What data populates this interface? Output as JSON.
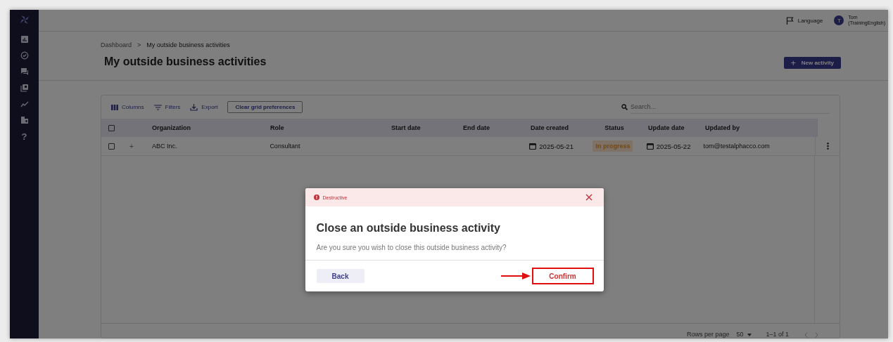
{
  "sidebar": {
    "help_glyph": "?"
  },
  "topbar": {
    "language": "Language",
    "user_initial": "T",
    "user_name": "Tom",
    "user_detail": "(TrainingEnglish)"
  },
  "breadcrumb": [
    "Dashboard",
    "My outside business activities"
  ],
  "breadcrumb_separator": ">",
  "page_title": "My outside business activities",
  "new_button": {
    "icon_glyph": "+",
    "label": "New activity"
  },
  "toolbar": {
    "columns": "Columns",
    "filters": "Filters",
    "export": "Export",
    "clear": "Clear grid preferences",
    "search_placeholder": "Search..."
  },
  "table": {
    "header_checked": false,
    "columns": [
      "Organization",
      "Role",
      "Start date",
      "End date",
      "Date created",
      "Status",
      "Update date",
      "Updated by"
    ],
    "rows": [
      {
        "checked": false,
        "expand_glyph": "+",
        "organization": "ABC Inc.",
        "role": "Consultant",
        "date_created": "2025-05-21",
        "status": "In progress",
        "update_date": "2025-05-22",
        "updated_by": "tom@testalphacco.com"
      }
    ]
  },
  "footer": {
    "rows_per_page_label": "Rows per page",
    "rows_per_page": "50",
    "range": "1–1 of 1"
  },
  "modal": {
    "tag": "Destructive",
    "title": "Close an outside business activity",
    "message": "Are you sure you wish to close this outside business activity?",
    "back": "Back",
    "confirm": "Confirm",
    "confirm_highlighted": true
  }
}
